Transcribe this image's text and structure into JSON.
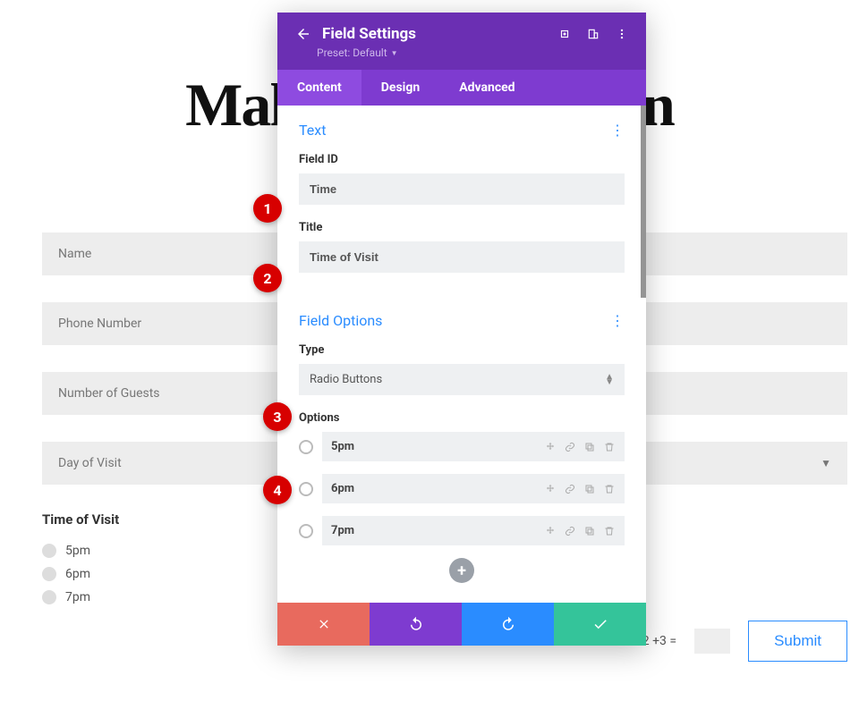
{
  "page": {
    "title": "Make a Reservation",
    "fields": {
      "name": "Name",
      "phone": "Phone Number",
      "guests": "Number of Guests",
      "day": "Day of Visit"
    },
    "time_of_visit": {
      "label": "Time of Visit",
      "options": [
        "5pm",
        "6pm",
        "7pm"
      ]
    },
    "captcha": "12 +3 =",
    "submit": "Submit"
  },
  "panel": {
    "header_title": "Field Settings",
    "preset_label": "Preset: Default",
    "tabs": {
      "content": "Content",
      "design": "Design",
      "advanced": "Advanced"
    },
    "sections": {
      "text": {
        "title": "Text",
        "field_id_label": "Field ID",
        "field_id_value": "Time",
        "title_label": "Title",
        "title_value": "Time of Visit"
      },
      "field_options": {
        "title": "Field Options",
        "type_label": "Type",
        "type_value": "Radio Buttons",
        "options_label": "Options",
        "options": [
          "5pm",
          "6pm",
          "7pm"
        ]
      }
    }
  },
  "badges": {
    "1": "1",
    "2": "2",
    "3": "3",
    "4": "4"
  }
}
